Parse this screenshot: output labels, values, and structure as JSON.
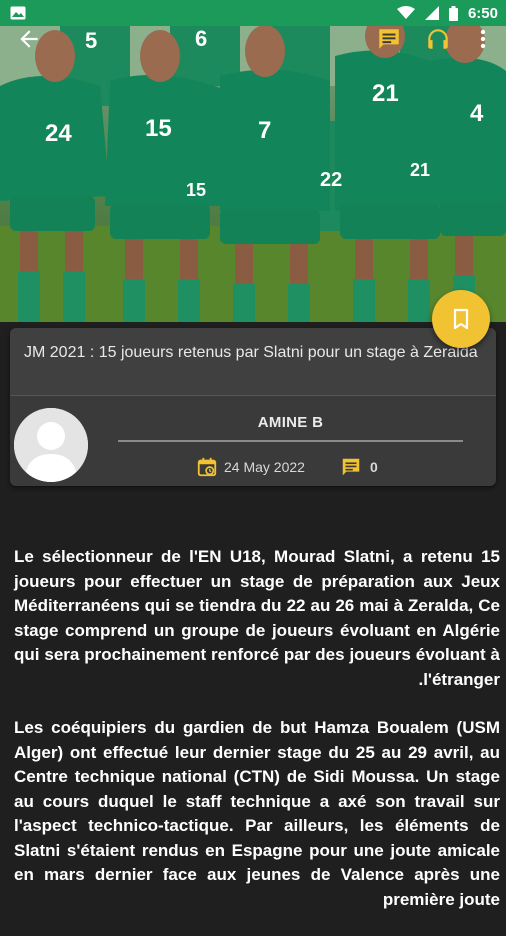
{
  "status_bar": {
    "time": "6:50",
    "icons": [
      "image-icon",
      "wifi-icon",
      "signal-icon",
      "battery-icon"
    ]
  },
  "toolbar": {
    "icons": [
      "back-arrow-icon",
      "comment-icon",
      "headphones-icon",
      "more-vert-icon"
    ],
    "accent_color": "#f1c232"
  },
  "article": {
    "title": "JM 2021 : 15 joueurs retenus par Slatni pour un stage à Zeralda",
    "author": "AMINE B",
    "date": "24 May 2022",
    "comment_count": "0",
    "paragraphs": [
      "Le sélectionneur de l'EN U18, Mourad Slatni, a retenu 15 joueurs pour effectuer un stage de préparation aux Jeux Méditerranéens qui se tiendra du 22 au 26 mai à Zeralda, Ce stage comprend un groupe de joueurs évoluant en Algérie qui sera prochainement renforcé par des joueurs évoluant à l'étranger.",
      "Les coéquipiers du gardien de but Hamza Boualem (USM Alger) ont effectué leur dernier stage du 25 au 29 avril, au Centre technique national (CTN) de Sidi Moussa. Un stage au cours duquel le staff technique a axé son travail sur l'aspect technico-tactique. Par ailleurs, les éléments de Slatni s'étaient rendus en Espagne pour une joute amicale en mars dernier face aux jeunes de Valence après une première joute"
    ]
  },
  "hero": {
    "jersey_numbers": [
      "24",
      "15",
      "7",
      "21",
      "4",
      "5",
      "6",
      "22",
      "15",
      "21"
    ]
  }
}
